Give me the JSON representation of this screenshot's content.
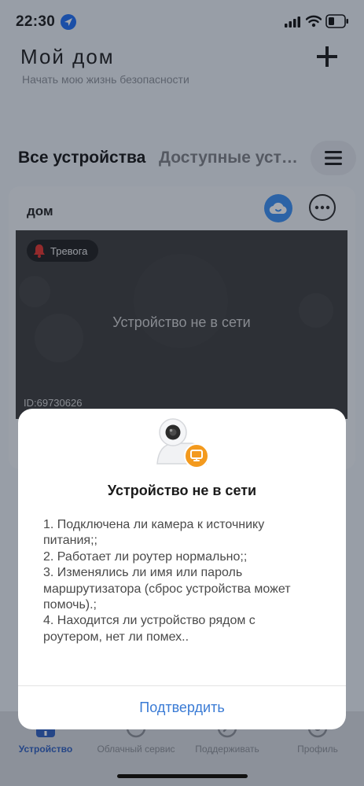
{
  "status_bar": {
    "time": "22:30"
  },
  "header": {
    "title": "Мой дом",
    "subtitle": "Начать мою жизнь безопасности"
  },
  "tabs": {
    "all": "Все устройства",
    "available": "Доступные устройства"
  },
  "device": {
    "name": "дом",
    "alarm_label": "Тревога",
    "status": "Устройство не в сети",
    "id": "ID:69730626"
  },
  "dialog": {
    "title": "Устройство не в сети",
    "body": "1. Подключена ли камера к источнику питания;;\n2. Работает ли роутер нормально;;\n3. Изменялись ли имя или пароль маршрутизатора (сброс устройства может помочь).;\n4. Находится ли устройство рядом с роутером, нет ли помех..",
    "confirm": "Подтвердить"
  },
  "bottom_nav": {
    "devices": "Устройство",
    "cloud": "Облачный сервис",
    "support": "Поддерживать",
    "profile": "Профиль"
  },
  "colors": {
    "accent": "#3a7bd5",
    "alarm": "#e0322d",
    "badge_orange": "#f39a1e"
  }
}
